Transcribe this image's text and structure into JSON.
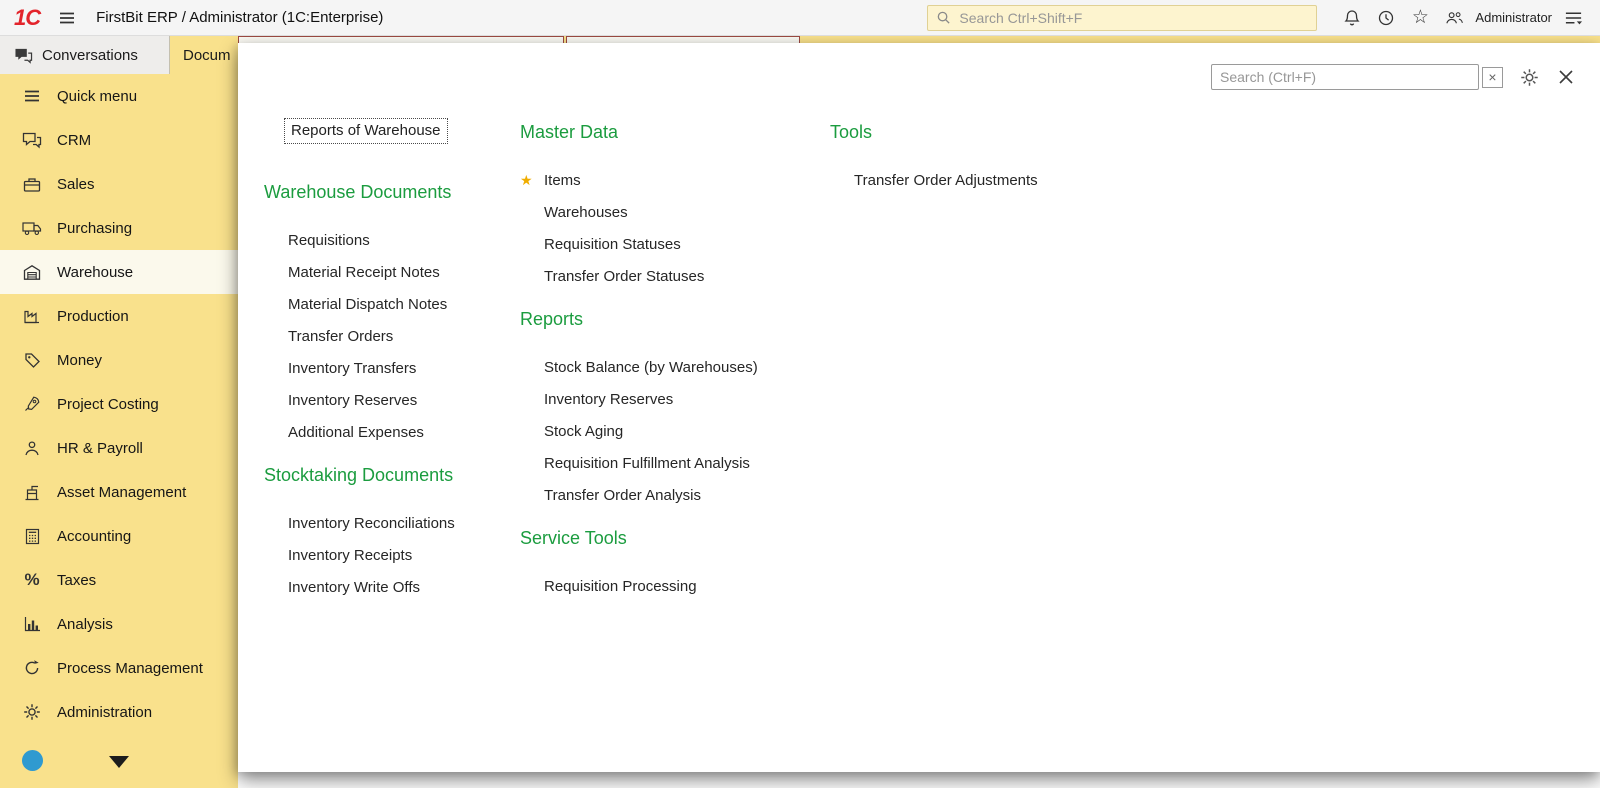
{
  "topbar": {
    "title": "FirstBit ERP / Administrator  (1C:Enterprise)",
    "search_placeholder": "Search Ctrl+Shift+F",
    "user_label": "Administrator",
    "logo_text": "1C"
  },
  "tabs": {
    "conversations": "Conversations",
    "documents_partial": "Docum"
  },
  "sidebar": {
    "active_item": "Warehouse",
    "items": [
      {
        "label": "Quick menu",
        "icon": "menu"
      },
      {
        "label": "CRM",
        "icon": "crm"
      },
      {
        "label": "Sales",
        "icon": "briefcase"
      },
      {
        "label": "Purchasing",
        "icon": "truck"
      },
      {
        "label": "Warehouse",
        "icon": "warehouse"
      },
      {
        "label": "Production",
        "icon": "factory"
      },
      {
        "label": "Money",
        "icon": "tag"
      },
      {
        "label": "Project Costing",
        "icon": "rocket"
      },
      {
        "label": "HR & Payroll",
        "icon": "person"
      },
      {
        "label": "Asset Management",
        "icon": "crane"
      },
      {
        "label": "Accounting",
        "icon": "calculator"
      },
      {
        "label": "Taxes",
        "icon": "percent"
      },
      {
        "label": "Analysis",
        "icon": "chart"
      },
      {
        "label": "Process Management",
        "icon": "cycle"
      },
      {
        "label": "Administration",
        "icon": "gear"
      }
    ]
  },
  "panel": {
    "search_placeholder": "Search (Ctrl+F)",
    "clear_button_label": "×",
    "focused_link": "Reports of Warehouse",
    "columns": [
      {
        "sections": [
          {
            "heading": "Warehouse Documents",
            "items": [
              "Requisitions",
              "Material Receipt Notes",
              "Material Dispatch Notes",
              "Transfer Orders",
              "Inventory Transfers",
              "Inventory Reserves",
              "Additional Expenses"
            ]
          },
          {
            "heading": "Stocktaking Documents",
            "items": [
              "Inventory Reconciliations",
              "Inventory Receipts",
              "Inventory Write Offs"
            ]
          }
        ]
      },
      {
        "sections": [
          {
            "heading": "Master Data",
            "starred_item": "Items",
            "items": [
              "Items",
              "Warehouses",
              "Requisition Statuses",
              "Transfer Order Statuses"
            ]
          },
          {
            "heading": "Reports",
            "items": [
              "Stock Balance (by Warehouses)",
              "Inventory Reserves",
              "Stock Aging",
              "Requisition Fulfillment Analysis",
              "Transfer Order Analysis"
            ]
          },
          {
            "heading": "Service Tools",
            "items": [
              "Requisition Processing"
            ]
          }
        ]
      },
      {
        "sections": [
          {
            "heading": "Tools",
            "items": [
              "Transfer Order Adjustments"
            ]
          }
        ]
      }
    ]
  },
  "colors": {
    "accent_green": "#1b9c3f",
    "sidebar_yellow": "#f9e18c",
    "brand_red": "#e3242b",
    "star_gold": "#f0ad00"
  }
}
